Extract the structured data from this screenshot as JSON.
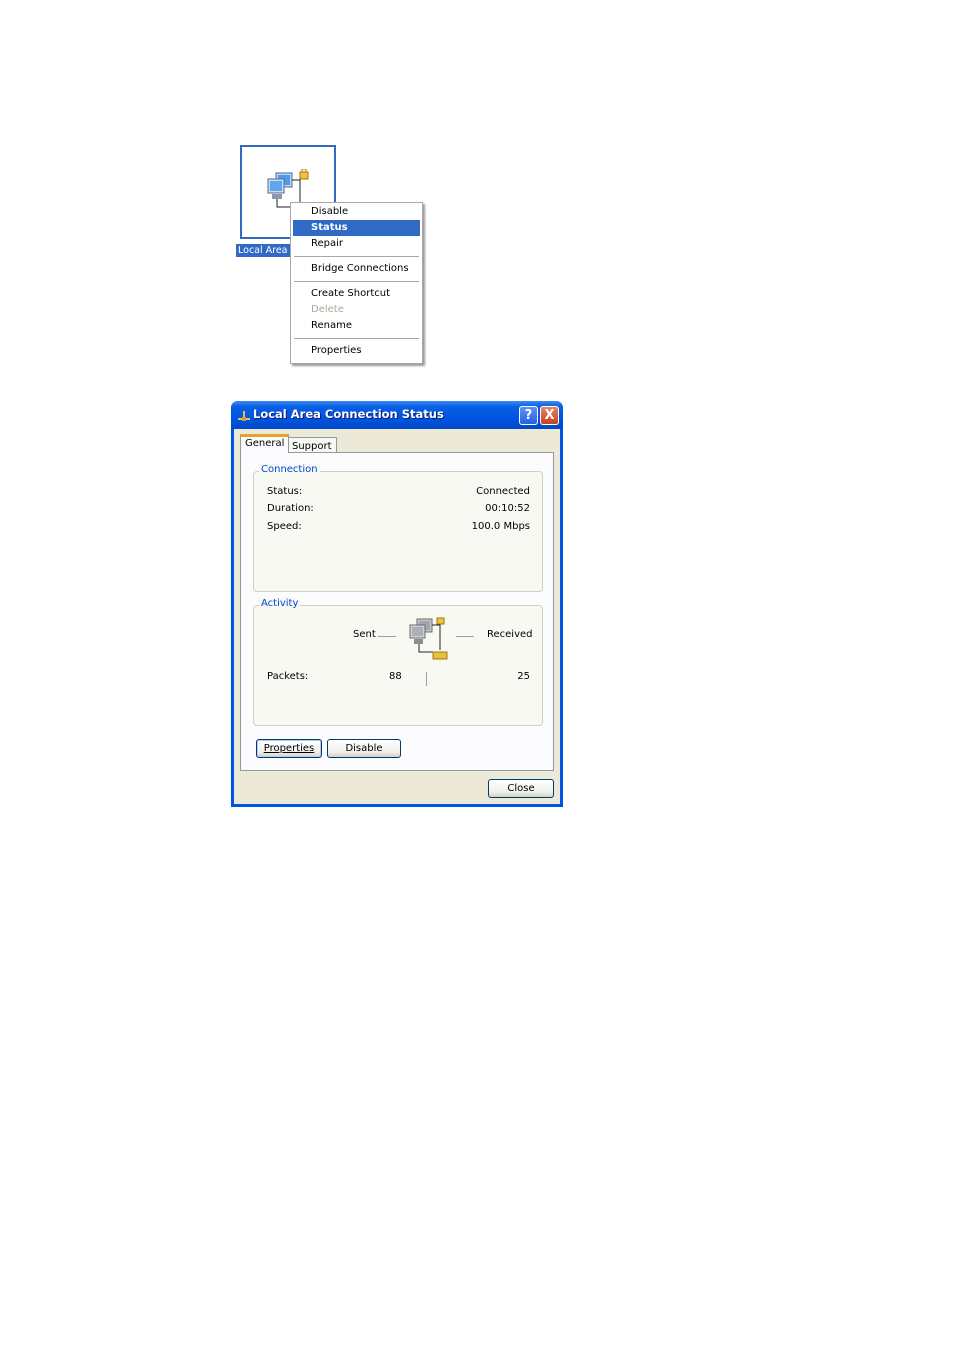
{
  "desktop": {
    "icon_label": "Local Area Connection"
  },
  "context_menu": {
    "items": [
      {
        "label": "Disable",
        "state": "normal"
      },
      {
        "label": "Status",
        "state": "selected"
      },
      {
        "label": "Repair",
        "state": "normal"
      },
      {
        "label": "Bridge Connections",
        "state": "normal"
      },
      {
        "label": "Create Shortcut",
        "state": "normal"
      },
      {
        "label": "Delete",
        "state": "disabled"
      },
      {
        "label": "Rename",
        "state": "normal"
      },
      {
        "label": "Properties",
        "state": "normal"
      }
    ]
  },
  "dialog": {
    "title": "Local Area Connection Status",
    "help_glyph": "?",
    "close_glyph": "X",
    "tabs": [
      "General",
      "Support"
    ],
    "active_tab": "General",
    "connection": {
      "title": "Connection",
      "rows": [
        {
          "label": "Status:",
          "value": "Connected"
        },
        {
          "label": "Duration:",
          "value": "00:10:52"
        },
        {
          "label": "Speed:",
          "value": "100.0 Mbps"
        }
      ]
    },
    "activity": {
      "title": "Activity",
      "sent_label": "Sent",
      "received_label": "Received",
      "packets_label": "Packets:",
      "packets_sent": "88",
      "packets_received": "25"
    },
    "buttons": {
      "properties": "Properties",
      "disable": "Disable",
      "close": "Close"
    }
  },
  "colors": {
    "selection": "#316ac5",
    "titlebar": "#0054e3",
    "group_title": "#0046d5",
    "dialog_bg": "#ece9d8"
  }
}
